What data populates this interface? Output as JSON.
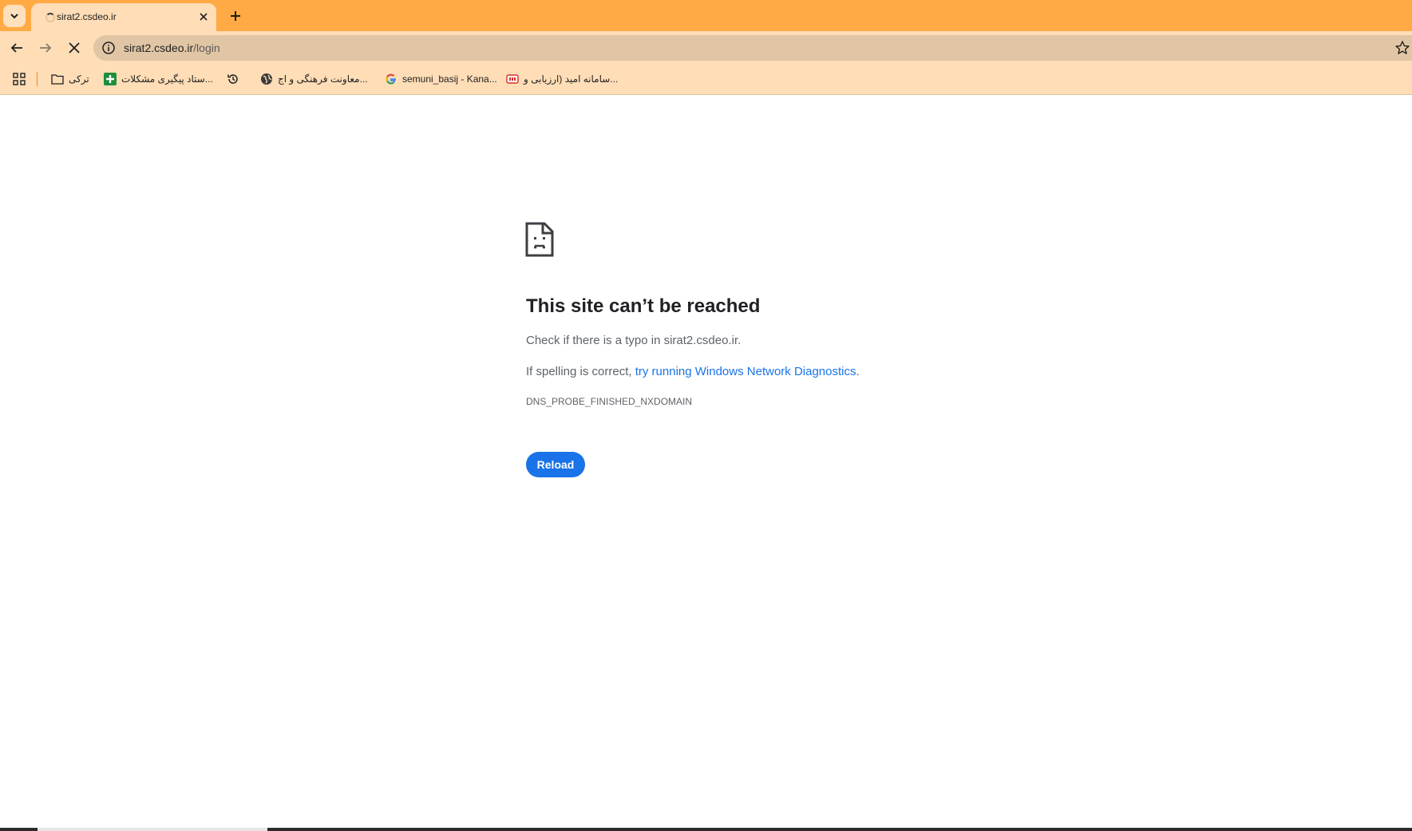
{
  "browser": {
    "tab": {
      "title": "sirat2.csdeo.ir"
    },
    "url": {
      "host": "sirat2.csdeo.ir",
      "path": "/login"
    },
    "bookmarks": [
      {
        "label": "ترکی",
        "icon": "folder-icon"
      },
      {
        "label": "ستاد پیگیری مشکلات...",
        "icon": "sheets-plus-icon"
      },
      {
        "label": "",
        "icon": "history-icon"
      },
      {
        "label": "معاونت فرهنگی و اج...",
        "icon": "globe-icon"
      },
      {
        "label": "semuni_basij - Kana...",
        "icon": "google-icon"
      },
      {
        "label": "سامانه امید (ارزیابی و...",
        "icon": "omid-icon"
      }
    ]
  },
  "error_page": {
    "title": "This site can’t be reached",
    "line1": "Check if there is a typo in sirat2.csdeo.ir.",
    "line2_prefix": "If spelling is correct, ",
    "line2_link": "try running Windows Network Diagnostics",
    "line2_suffix": ".",
    "code": "DNS_PROBE_FINISHED_NXDOMAIN",
    "reload_label": "Reload"
  },
  "colors": {
    "tabstrip": "#ffaa44",
    "toolbar": "#ffddb6",
    "omnibox": "#e1c6a5",
    "link": "#1a73e8",
    "button": "#1a73e8"
  }
}
